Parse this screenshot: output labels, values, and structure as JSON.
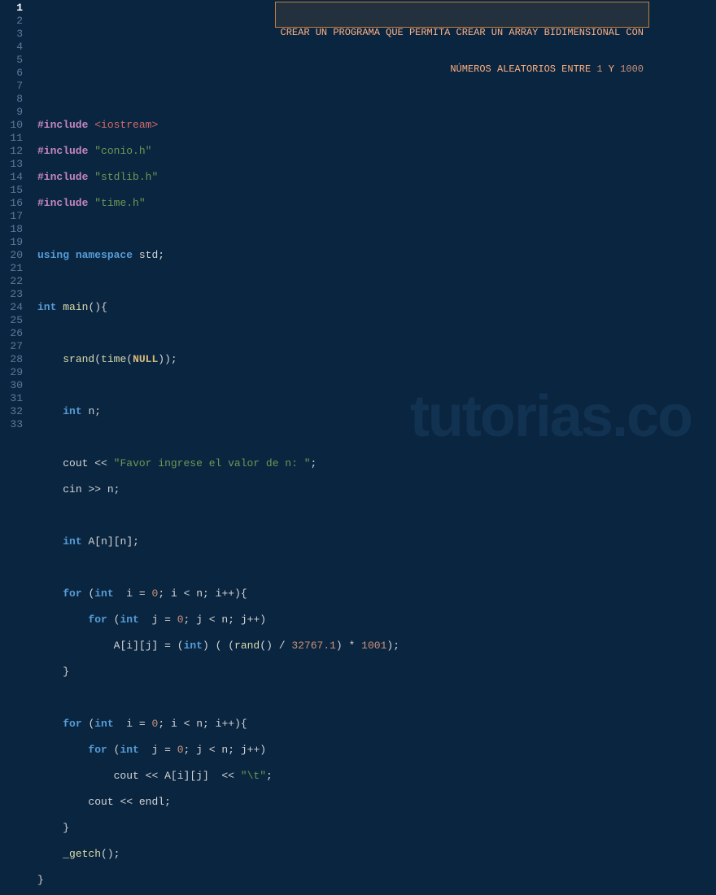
{
  "banner": {
    "line1": "CREAR UN PROGRAMA QUE PERMITA CREAR UN ARRAY BIDIMENSIONAL CON",
    "line2_a": "NÚMEROS ALEATORIOS ENTRE ",
    "line2_b": "1",
    "line2_c": " Y ",
    "line2_d": "1000"
  },
  "watermark": "tutorias.co",
  "lineCount": 33,
  "currentLine": 1,
  "tokens": {
    "pp_include": "#include",
    "inc_iostream": "<iostream>",
    "inc_conio": "\"conio.h\"",
    "inc_stdlib": "\"stdlib.h\"",
    "inc_time": "\"time.h\"",
    "kw_using": "using",
    "kw_namespace": "namespace",
    "id_std": "std",
    "kw_int": "int",
    "fn_main": "main",
    "fn_srand": "srand",
    "fn_time": "time",
    "const_null": "NULL",
    "id_n": "n",
    "id_cout": "cout",
    "id_cin": "cin",
    "id_endl": "endl",
    "str_prompt": "\"Favor ingrese el valor de n: \"",
    "id_A": "A",
    "kw_for": "for",
    "id_i": "i",
    "id_j": "j",
    "num_0": "0",
    "fn_rand": "rand",
    "num_div": "32767.1",
    "num_mul": "1001",
    "str_tab": "\"\\t\"",
    "fn_getch": "_getch",
    "op_ins": "<<",
    "op_ext": ">>",
    "op_inc": "++",
    "op_semi": ";",
    "op_lt": "<",
    "op_eq": "=",
    "op_lp": "(",
    "op_rp": ")",
    "op_lb": "{",
    "op_rb": "}",
    "op_lsb": "[",
    "op_rsb": "]",
    "op_comma": ",",
    "op_div": "/",
    "op_mul": "*",
    "sp": " "
  }
}
